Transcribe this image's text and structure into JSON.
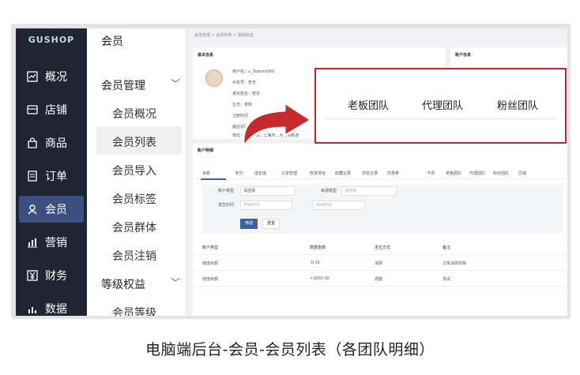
{
  "nav": {
    "logo": "GUSHOP",
    "items": [
      {
        "label": "概况"
      },
      {
        "label": "店铺"
      },
      {
        "label": "商品"
      },
      {
        "label": "订单"
      },
      {
        "label": "会员"
      },
      {
        "label": "营销"
      },
      {
        "label": "财务"
      },
      {
        "label": "数据"
      }
    ]
  },
  "subnav": {
    "title": "会员",
    "group1": "会员管理",
    "items1": [
      "会员概况",
      "会员列表",
      "会员导入",
      "会员标签",
      "会员群体",
      "会员注销"
    ],
    "group2": "等级权益",
    "items2": [
      "会员等级"
    ]
  },
  "main": {
    "breadcrumb": "会员管理 > 会员列表 > 基础信息",
    "basic_title": "基本信息",
    "account_title": "账户信息",
    "basic_fields": [
      "用户名：u_5bemn0RU",
      "手机号：暂无",
      "真实姓名：暂无",
      "生日：未知",
      "注册时间",
      "最后访问",
      "地址：...未分享...上海市...大直街街道"
    ],
    "detail_title": "账户明细",
    "tabs": [
      "余额",
      "积分",
      "成长值",
      "订单管理",
      "收货地址",
      "收藏记录",
      "浏览记录",
      "优惠券",
      "卡项",
      "老板团队",
      "代理团队",
      "粉丝团队",
      "区域"
    ],
    "filter": {
      "type_label": "账户类型",
      "type_placeholder": "请选择",
      "source_label": "来源类型",
      "source_placeholder": "请选择",
      "time_label": "发生时间",
      "start_placeholder": "开始时间",
      "end_placeholder": "结束时间",
      "range_sep": "-",
      "filter_btn": "筛选",
      "reset_btn": "重置"
    },
    "table": {
      "headers": [
        "账户类型",
        "数据金额",
        "发生方式",
        "备注"
      ],
      "rows": [
        [
          "储值余额",
          "-0.01",
          "消费",
          "订单消费扣除"
        ],
        [
          "储值余额",
          "+3000.00",
          "调整",
          "测试"
        ]
      ]
    }
  },
  "overlay": {
    "teams": [
      "老板团队",
      "代理团队",
      "粉丝团队"
    ]
  },
  "caption": "电脑端后台-会员-会员列表（各团队明细）",
  "colors": {
    "nav_bg": "#1f2533",
    "nav_active": "#3d4f7e",
    "highlight_border": "#c0282e",
    "arrow": "#c62a2a",
    "primary_btn": "#3d5fa6"
  }
}
